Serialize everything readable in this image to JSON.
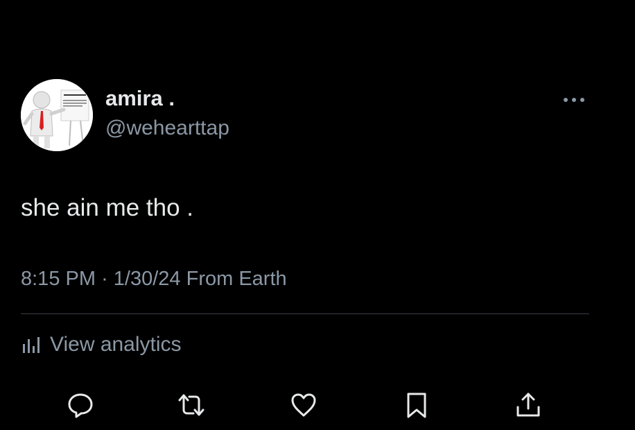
{
  "tweet": {
    "author": {
      "display_name": "amira .",
      "handle": "@wehearttap"
    },
    "text": "she ain me tho .",
    "meta": {
      "time": "8:15 PM",
      "separator": "·",
      "date": "1/30/24",
      "source": "From Earth"
    },
    "analytics_label": "View analytics"
  },
  "icons": {
    "more": "more-horizontal-icon",
    "analytics": "bar-chart-icon",
    "reply": "reply-bubble-icon",
    "retweet": "retweet-icon",
    "like": "heart-icon",
    "bookmark": "bookmark-icon",
    "share": "share-upload-icon"
  },
  "colors": {
    "background": "#000000",
    "primary_text": "#e7e9ea",
    "secondary_text": "#8b98a5",
    "divider": "#3a3f44",
    "icon": "#e7e9ea"
  }
}
